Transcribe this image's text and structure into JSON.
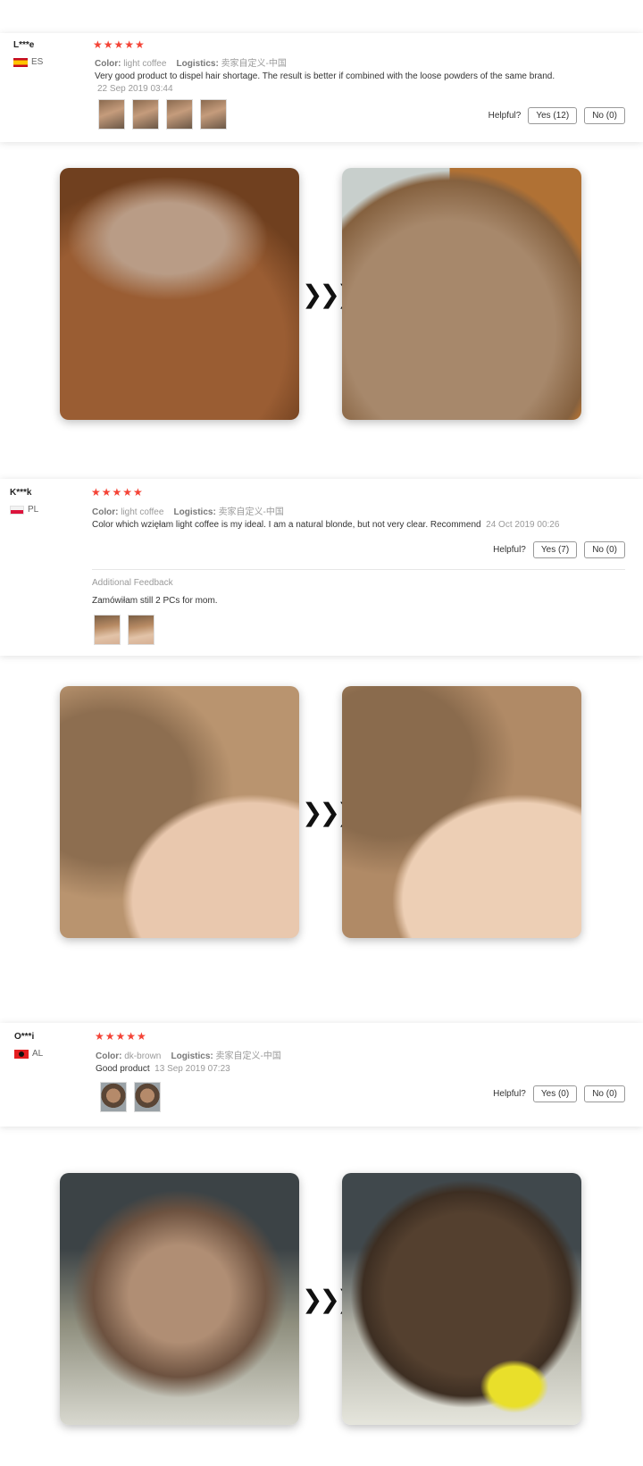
{
  "helpful_label": "Helpful?",
  "reviews": [
    {
      "user": "L***e",
      "country": "ES",
      "stars": "★★★★★",
      "color_label": "Color:",
      "color_value": "light coffee",
      "logistics_label": "Logistics:",
      "logistics_value": "卖家自定义-中国",
      "text": "Very good product to dispel hair shortage. The result is better if combined with the loose powders of the same brand.",
      "date": "22 Sep 2019 03:44",
      "yes": "Yes (12)",
      "no": "No (0)"
    },
    {
      "user": "K***k",
      "country": "PL",
      "stars": "★★★★★",
      "color_label": "Color:",
      "color_value": "light coffee",
      "logistics_label": "Logistics:",
      "logistics_value": "卖家自定义-中国",
      "text": "Color which wzięłam light coffee is my ideal. I am a natural blonde, but not very clear. Recommend",
      "date": "24 Oct 2019 00:26",
      "yes": "Yes (7)",
      "no": "No (0)",
      "additional_title": "Additional Feedback",
      "additional_text": "Zamówiłam still 2 PCs for mom."
    },
    {
      "user": "O***i",
      "country": "AL",
      "stars": "★★★★★",
      "color_label": "Color:",
      "color_value": "dk-brown",
      "logistics_label": "Logistics:",
      "logistics_value": "卖家自定义-中国",
      "text": "Good product",
      "date": "13 Sep 2019 07:23",
      "yes": "Yes (0)",
      "no": "No (0)"
    }
  ],
  "arrow": "❯❯❯"
}
